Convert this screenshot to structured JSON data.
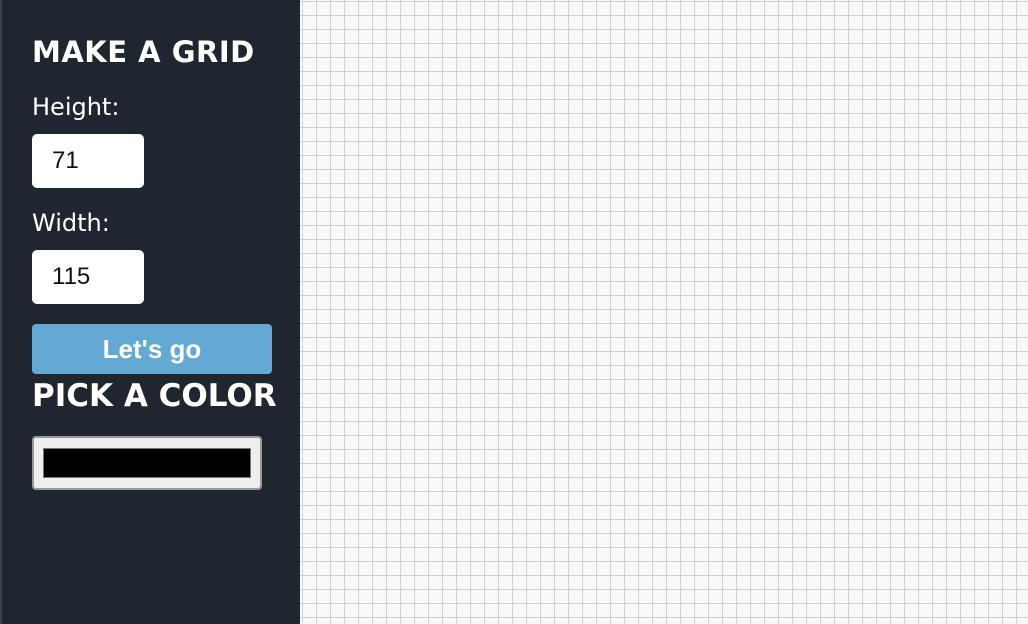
{
  "sidebar": {
    "title": "MAKE A GRID",
    "height_label": "Height:",
    "height_value": "71",
    "width_label": "Width:",
    "width_value": "115",
    "submit_label": "Let's go",
    "color_title": "PICK A COLOR",
    "color_value": "#000000"
  },
  "colors": {
    "sidebar_bg": "#1f2630",
    "button_bg": "#63a9d3",
    "grid_line": "#cfd0d3",
    "grid_bg": "#f8f9fb"
  }
}
